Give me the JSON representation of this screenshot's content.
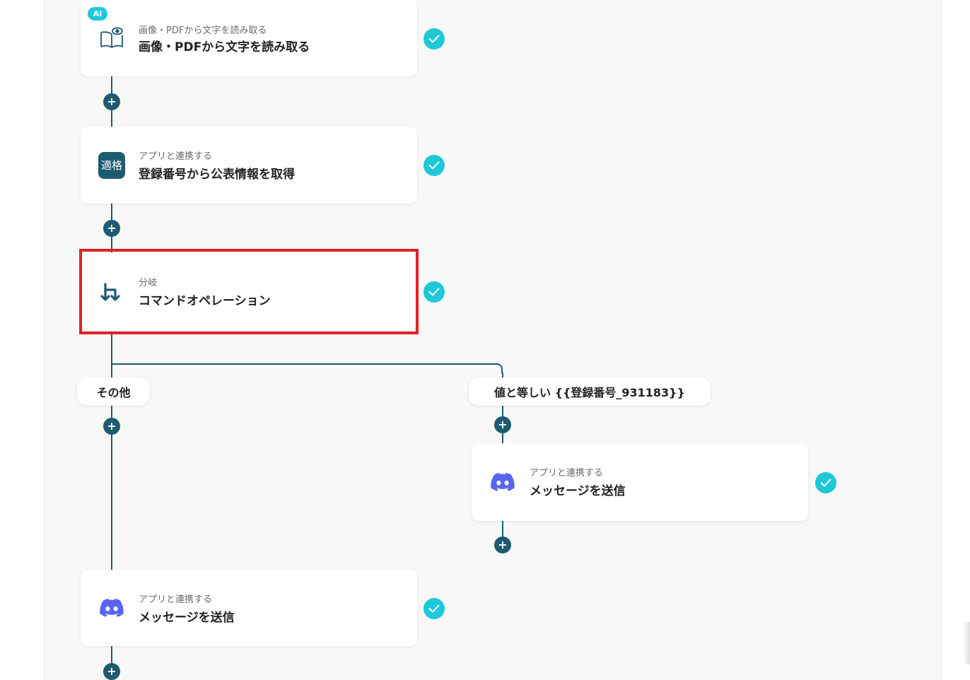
{
  "colors": {
    "line": "#1d5b71",
    "check": "#1ec8d8",
    "highlight": "#e12127",
    "discord": "#5865f2"
  },
  "steps": [
    {
      "badge": "AI",
      "sub": "画像・PDFから文字を読み取る",
      "title": "画像・PDFから文字を読み取る",
      "icon": "ocr-book-eye-icon"
    },
    {
      "sub": "アプリと連携する",
      "title": "登録番号から公表情報を取得",
      "icon": "tekikaku-app-icon",
      "icon_text": "適格"
    },
    {
      "sub": "分岐",
      "title": "コマンドオペレーション",
      "icon": "branch-icon"
    }
  ],
  "branches": {
    "left": {
      "label": "その他",
      "step": {
        "sub": "アプリと連携する",
        "title": "メッセージを送信",
        "icon": "discord-icon"
      }
    },
    "right": {
      "label": "値と等しい {{登録番号_931183}}",
      "step": {
        "sub": "アプリと連携する",
        "title": "メッセージを送信",
        "icon": "discord-icon"
      }
    }
  },
  "add_button_symbol": "+"
}
